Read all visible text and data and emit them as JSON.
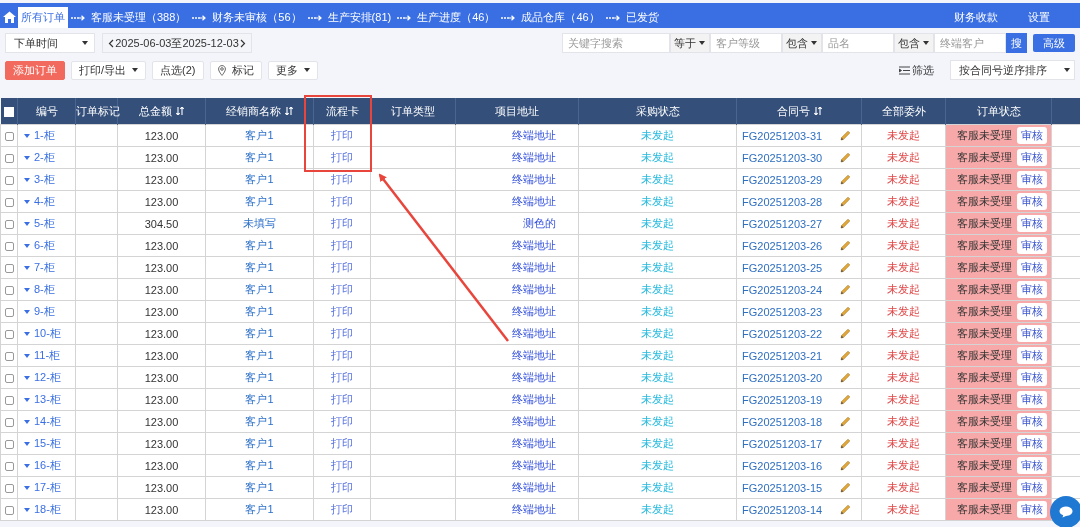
{
  "nav": {
    "tabs": [
      {
        "label": "所有订单",
        "selected": true
      },
      {
        "label": "客服未受理（388）",
        "selected": false
      },
      {
        "label": "财务未审核（56）",
        "selected": false
      },
      {
        "label": "生产安排(81)",
        "selected": false
      },
      {
        "label": "生产进度（46）",
        "selected": false
      },
      {
        "label": "成品仓库（46）",
        "selected": false
      },
      {
        "label": "已发货",
        "selected": false
      }
    ],
    "links": [
      "财务收款",
      "设置"
    ]
  },
  "filters": {
    "date_field": "下单时间",
    "date_range": "2025-06-03至2025-12-03",
    "keyword": {
      "placeholder": "关键字搜索"
    },
    "conditions": [
      {
        "operator": "等于",
        "placeholder": "客户等级"
      },
      {
        "operator": "包含",
        "placeholder": "品名"
      },
      {
        "operator": "包含",
        "placeholder": "终端客户"
      }
    ],
    "search_button": "搜",
    "advanced_button": "高级"
  },
  "actions": {
    "buttons": [
      {
        "label": "添加订单",
        "kind": "primary"
      },
      {
        "label": "打印/导出",
        "kind": "dropdown"
      },
      {
        "label": "点选(2)",
        "kind": "plain"
      },
      {
        "label": "标记",
        "kind": "pin"
      },
      {
        "label": "更多",
        "kind": "dropdown"
      }
    ],
    "filter_label": "筛选",
    "sort": "按合同号逆序排序"
  },
  "table": {
    "select_all": {
      "checked": false
    },
    "columns": [
      {
        "label": "编号",
        "sortable": false
      },
      {
        "label": "订单标记",
        "sortable": false
      },
      {
        "label": "总金额",
        "sortable": true
      },
      {
        "label": "经销商名称",
        "sortable": true
      },
      {
        "label": "流程卡",
        "sortable": false
      },
      {
        "label": "订单类型",
        "sortable": false
      },
      {
        "label": "项目地址",
        "sortable": false
      },
      {
        "label": "采购状态",
        "sortable": false
      },
      {
        "label": "合同号",
        "sortable": true
      },
      {
        "label": "全部委外",
        "sortable": false
      },
      {
        "label": "订单状态",
        "sortable": false
      }
    ],
    "rows": [
      {
        "checked": false,
        "number": "1-柜",
        "amount": "123.00",
        "dealer": "客户1",
        "card": "打印",
        "address": "终端地址",
        "purchase": "未发起",
        "contract": "FG20251203-31",
        "outsource": "未发起",
        "status": "客服未受理",
        "action": "审核"
      },
      {
        "checked": false,
        "number": "2-柜",
        "amount": "123.00",
        "dealer": "客户1",
        "card": "打印",
        "address": "终端地址",
        "purchase": "未发起",
        "contract": "FG20251203-30",
        "outsource": "未发起",
        "status": "客服未受理",
        "action": "审核"
      },
      {
        "checked": false,
        "number": "3-柜",
        "amount": "123.00",
        "dealer": "客户1",
        "card": "打印",
        "address": "终端地址",
        "purchase": "未发起",
        "contract": "FG20251203-29",
        "outsource": "未发起",
        "status": "客服未受理",
        "action": "审核"
      },
      {
        "checked": false,
        "number": "4-柜",
        "amount": "123.00",
        "dealer": "客户1",
        "card": "打印",
        "address": "终端地址",
        "purchase": "未发起",
        "contract": "FG20251203-28",
        "outsource": "未发起",
        "status": "客服未受理",
        "action": "审核"
      },
      {
        "checked": false,
        "number": "5-柜",
        "amount": "304.50",
        "dealer": "未填写",
        "card": "打印",
        "address": "测色的",
        "purchase": "未发起",
        "contract": "FG20251203-27",
        "outsource": "未发起",
        "status": "客服未受理",
        "action": "审核"
      },
      {
        "checked": false,
        "number": "6-柜",
        "amount": "123.00",
        "dealer": "客户1",
        "card": "打印",
        "address": "终端地址",
        "purchase": "未发起",
        "contract": "FG20251203-26",
        "outsource": "未发起",
        "status": "客服未受理",
        "action": "审核"
      },
      {
        "checked": false,
        "number": "7-柜",
        "amount": "123.00",
        "dealer": "客户1",
        "card": "打印",
        "address": "终端地址",
        "purchase": "未发起",
        "contract": "FG20251203-25",
        "outsource": "未发起",
        "status": "客服未受理",
        "action": "审核"
      },
      {
        "checked": false,
        "number": "8-柜",
        "amount": "123.00",
        "dealer": "客户1",
        "card": "打印",
        "address": "终端地址",
        "purchase": "未发起",
        "contract": "FG20251203-24",
        "outsource": "未发起",
        "status": "客服未受理",
        "action": "审核"
      },
      {
        "checked": false,
        "number": "9-柜",
        "amount": "123.00",
        "dealer": "客户1",
        "card": "打印",
        "address": "终端地址",
        "purchase": "未发起",
        "contract": "FG20251203-23",
        "outsource": "未发起",
        "status": "客服未受理",
        "action": "审核"
      },
      {
        "checked": false,
        "number": "10-柜",
        "amount": "123.00",
        "dealer": "客户1",
        "card": "打印",
        "address": "终端地址",
        "purchase": "未发起",
        "contract": "FG20251203-22",
        "outsource": "未发起",
        "status": "客服未受理",
        "action": "审核"
      },
      {
        "checked": false,
        "number": "11-柜",
        "amount": "123.00",
        "dealer": "客户1",
        "card": "打印",
        "address": "终端地址",
        "purchase": "未发起",
        "contract": "FG20251203-21",
        "outsource": "未发起",
        "status": "客服未受理",
        "action": "审核"
      },
      {
        "checked": false,
        "number": "12-柜",
        "amount": "123.00",
        "dealer": "客户1",
        "card": "打印",
        "address": "终端地址",
        "purchase": "未发起",
        "contract": "FG20251203-20",
        "outsource": "未发起",
        "status": "客服未受理",
        "action": "审核"
      },
      {
        "checked": false,
        "number": "13-柜",
        "amount": "123.00",
        "dealer": "客户1",
        "card": "打印",
        "address": "终端地址",
        "purchase": "未发起",
        "contract": "FG20251203-19",
        "outsource": "未发起",
        "status": "客服未受理",
        "action": "审核"
      },
      {
        "checked": false,
        "number": "14-柜",
        "amount": "123.00",
        "dealer": "客户1",
        "card": "打印",
        "address": "终端地址",
        "purchase": "未发起",
        "contract": "FG20251203-18",
        "outsource": "未发起",
        "status": "客服未受理",
        "action": "审核"
      },
      {
        "checked": false,
        "number": "15-柜",
        "amount": "123.00",
        "dealer": "客户1",
        "card": "打印",
        "address": "终端地址",
        "purchase": "未发起",
        "contract": "FG20251203-17",
        "outsource": "未发起",
        "status": "客服未受理",
        "action": "审核"
      },
      {
        "checked": false,
        "number": "16-柜",
        "amount": "123.00",
        "dealer": "客户1",
        "card": "打印",
        "address": "终端地址",
        "purchase": "未发起",
        "contract": "FG20251203-16",
        "outsource": "未发起",
        "status": "客服未受理",
        "action": "审核"
      },
      {
        "checked": false,
        "number": "17-柜",
        "amount": "123.00",
        "dealer": "客户1",
        "card": "打印",
        "address": "终端地址",
        "purchase": "未发起",
        "contract": "FG20251203-15",
        "outsource": "未发起",
        "status": "客服未受理",
        "action": "审核"
      },
      {
        "checked": false,
        "number": "18-柜",
        "amount": "123.00",
        "dealer": "客户1",
        "card": "打印",
        "address": "终端地址",
        "purchase": "未发起",
        "contract": "FG20251203-14",
        "outsource": "未发起",
        "status": "客服未受理",
        "action": "审核"
      }
    ]
  }
}
